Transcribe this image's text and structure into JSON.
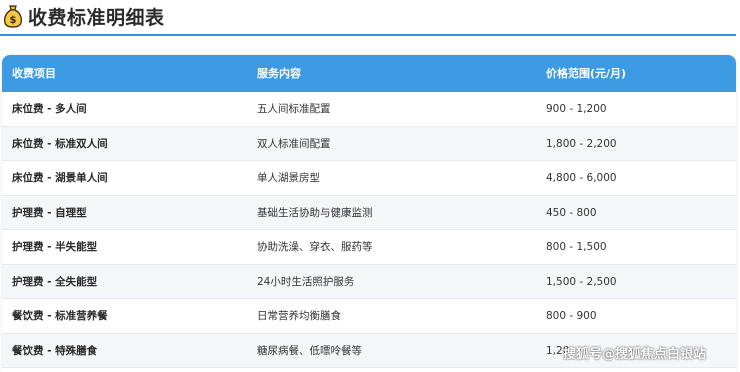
{
  "page": {
    "title": "收费标准明细表",
    "icon": "money-bag-icon"
  },
  "table": {
    "headers": [
      "收费项目",
      "服务内容",
      "价格范围(元/月)"
    ],
    "rows": [
      {
        "item": "床位费 - 多人间",
        "service": "五人间标准配置",
        "price": "900 - 1,200"
      },
      {
        "item": "床位费 - 标准双人间",
        "service": "双人标准间配置",
        "price": "1,800 - 2,200"
      },
      {
        "item": "床位费 - 湖景单人间",
        "service": "单人湖景房型",
        "price": "4,800 - 6,000"
      },
      {
        "item": "护理费 - 自理型",
        "service": "基础生活协助与健康监测",
        "price": "450 - 800"
      },
      {
        "item": "护理费 - 半失能型",
        "service": "协助洗澡、穿衣、服药等",
        "price": "800 - 1,500"
      },
      {
        "item": "护理费 - 全失能型",
        "service": "24小时生活照护服务",
        "price": "1,500 - 2,500"
      },
      {
        "item": "餐饮费 - 标准营养餐",
        "service": "日常营养均衡膳食",
        "price": "800 - 900"
      },
      {
        "item": "餐饮费 - 特殊膳食",
        "service": "糖尿病餐、低嘌呤餐等",
        "price": "1,20"
      }
    ]
  },
  "watermark": "搜狐号@搜狐焦点白银站",
  "colors": {
    "header_bg": "#3d9be4",
    "title_rule": "#3b8fd6",
    "alt_row": "#f5f6f8"
  }
}
